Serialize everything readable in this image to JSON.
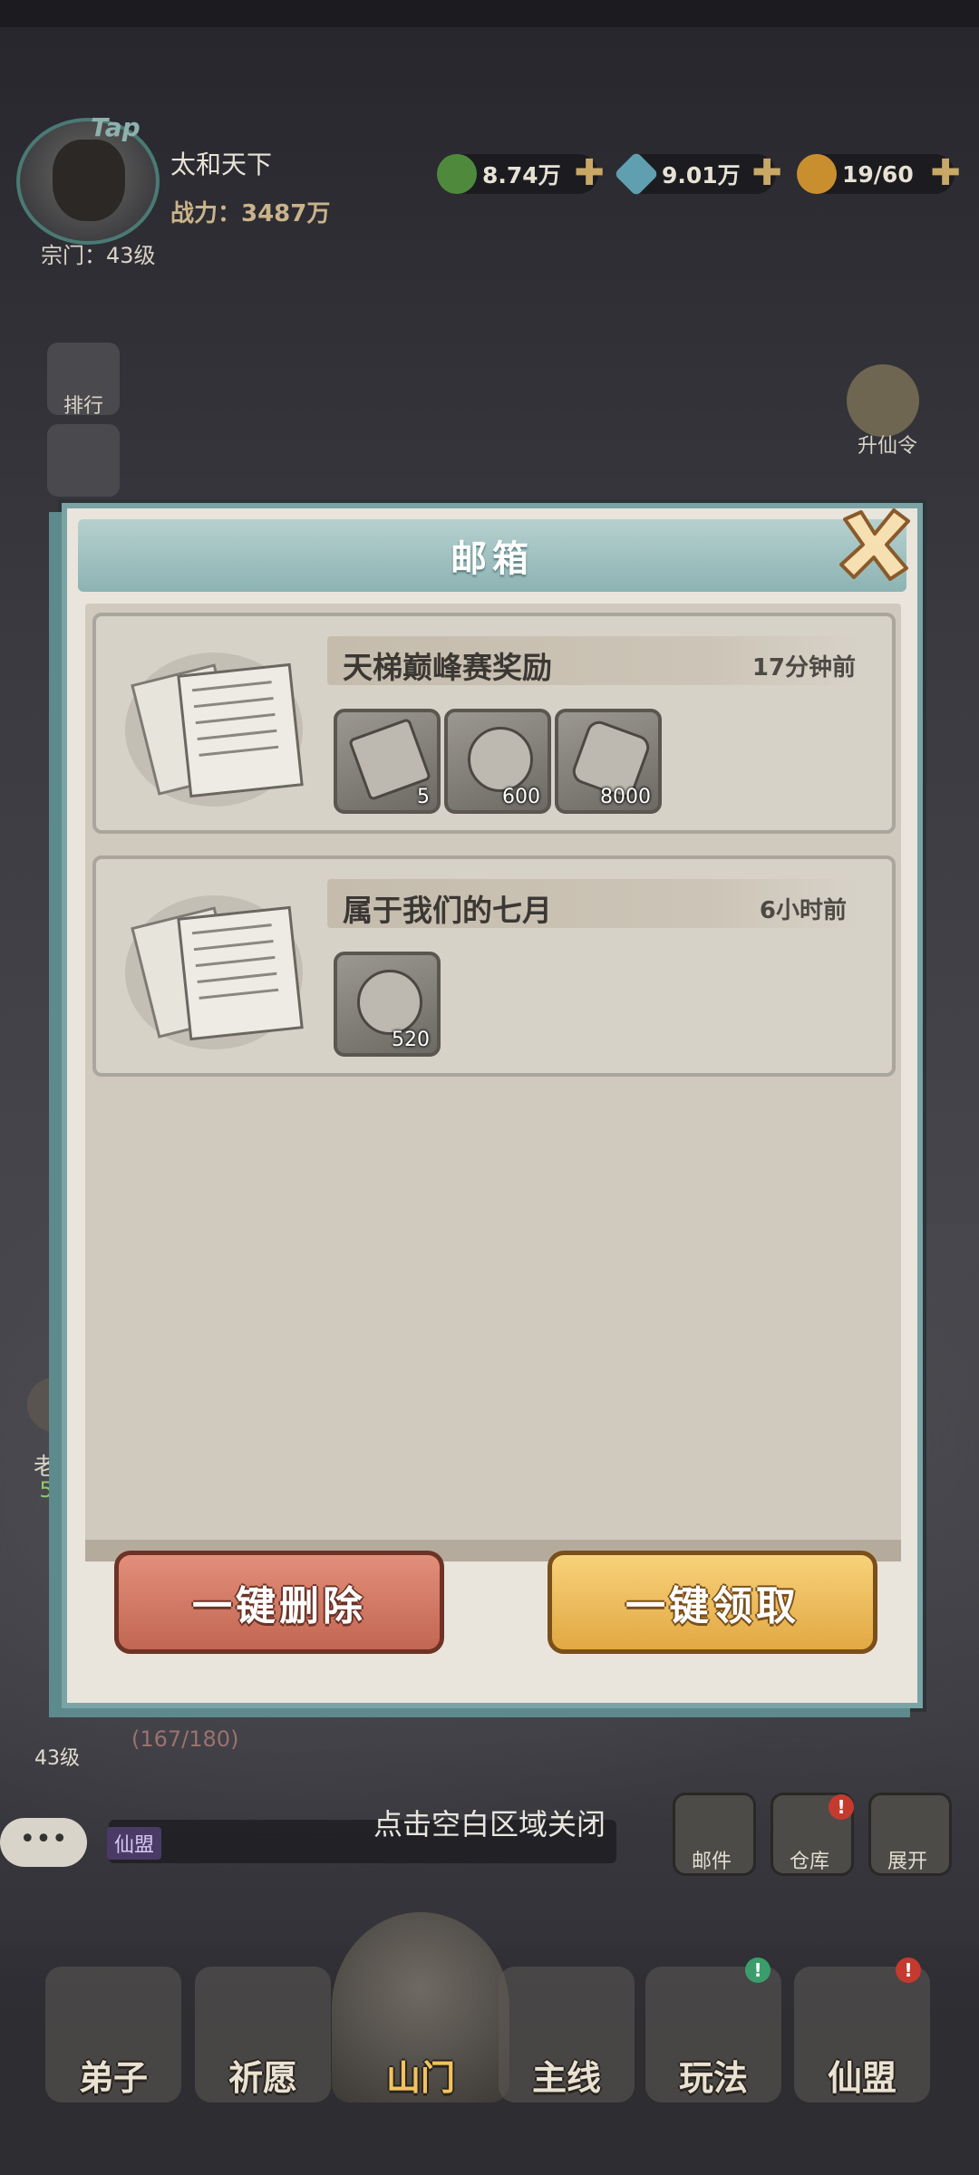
{
  "hud": {
    "tap_label": "Tap",
    "player_name": "太和天下",
    "power": "战力：3487万",
    "sect_level": "宗门：43级",
    "resources": [
      {
        "icon": "jade-coin-icon",
        "value": "8.74万",
        "color": "#4f8a3c"
      },
      {
        "icon": "spirit-gem-icon",
        "value": "9.01万",
        "color": "#5f9fb0"
      },
      {
        "icon": "gourd-icon",
        "value": "19/60",
        "color": "#c98f2e"
      }
    ]
  },
  "side_left": {
    "ranking": "排行",
    "elder_partial": "老",
    "elder_num": "5"
  },
  "side_right": {
    "ascend": "升仙令"
  },
  "mailbox": {
    "title": "邮箱",
    "mails": [
      {
        "title": "天梯巅峰赛奖励",
        "time": "17分钟前",
        "items": [
          {
            "icon": "scroll-ticket-icon",
            "qty": "5"
          },
          {
            "icon": "sword-medal-icon",
            "qty": "600"
          },
          {
            "icon": "spirit-stone-icon",
            "qty": "8000"
          }
        ]
      },
      {
        "title": "属于我们的七月",
        "time": "6小时前",
        "items": [
          {
            "icon": "dragon-jade-icon",
            "qty": "520"
          }
        ]
      }
    ],
    "delete_all": "一键删除",
    "claim_all": "一键领取"
  },
  "close_hint": "点击空白区域关闭",
  "below_modal": {
    "level": "43级",
    "hp": "(167/180)",
    "guild_tag": "仙盟"
  },
  "quick_buttons": {
    "mail": "邮件",
    "warehouse": "仓库",
    "expand": "展开"
  },
  "bottom_nav": [
    {
      "label": "弟子"
    },
    {
      "label": "祈愿"
    },
    {
      "label": "山门"
    },
    {
      "label": "主线"
    },
    {
      "label": "玩法"
    },
    {
      "label": "仙盟"
    }
  ]
}
